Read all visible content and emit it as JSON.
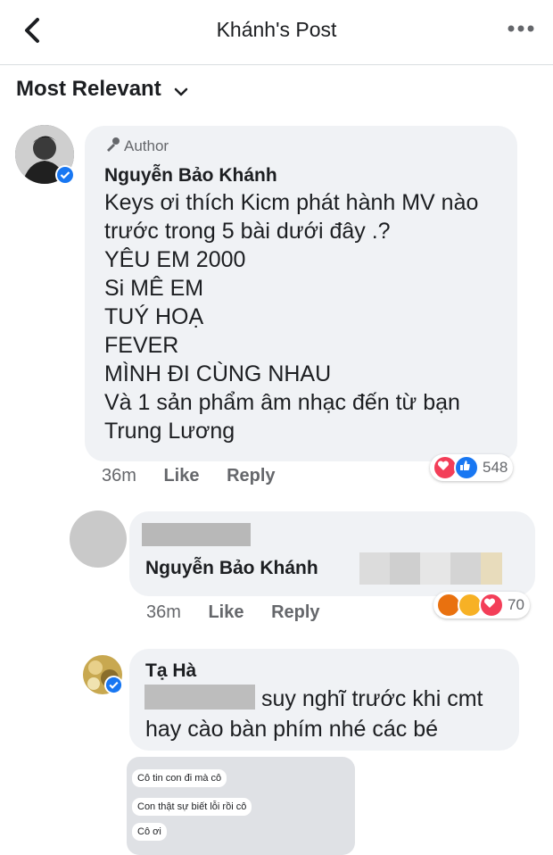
{
  "header": {
    "title": "Khánh's Post",
    "back_icon": "chevron-left-icon",
    "more_icon": "more-dots-icon"
  },
  "sort": {
    "label": "Most Relevant",
    "icon": "chevron-down-icon"
  },
  "comments": [
    {
      "author_badge": "Author",
      "name": "Nguyễn Bảo Khánh",
      "text": "Keys ơi thích Kicm phát hành MV nào\ntrước trong 5 bài dưới đây .?\nYÊU EM 2000\nSi MÊ EM\nTUÝ HOẠ\nFEVER\nMÌNH ĐI CÙNG NHAU\nVà 1 sản phẩm âm nhạc đến từ bạn\nTrung Lương",
      "time": "36m",
      "like": "Like",
      "reply": "Reply",
      "reactions": [
        "love",
        "like"
      ],
      "reaction_count": "548"
    },
    {
      "mention": "Nguyễn Bảo Khánh",
      "time": "36m",
      "like": "Like",
      "reply": "Reply",
      "reactions": [
        "angry",
        "haha",
        "love"
      ],
      "reaction_count": "70"
    },
    {
      "name": "Tạ Hà",
      "text_line1": "suy nghĩ trước khi cmt",
      "text_line2": "hay cào bàn phím nhé các bé"
    }
  ],
  "screenshot_messages": [
    "Cô tin con đi mà cô",
    "Con thật sự biết lỗi rồi cô",
    "Cô ơi"
  ],
  "colors": {
    "like_blue": "#1877f2",
    "love_red": "#f33e58",
    "haha_yellow": "#f7b125",
    "angry_orange": "#e9710f",
    "bubble_gray": "#f0f2f5"
  }
}
